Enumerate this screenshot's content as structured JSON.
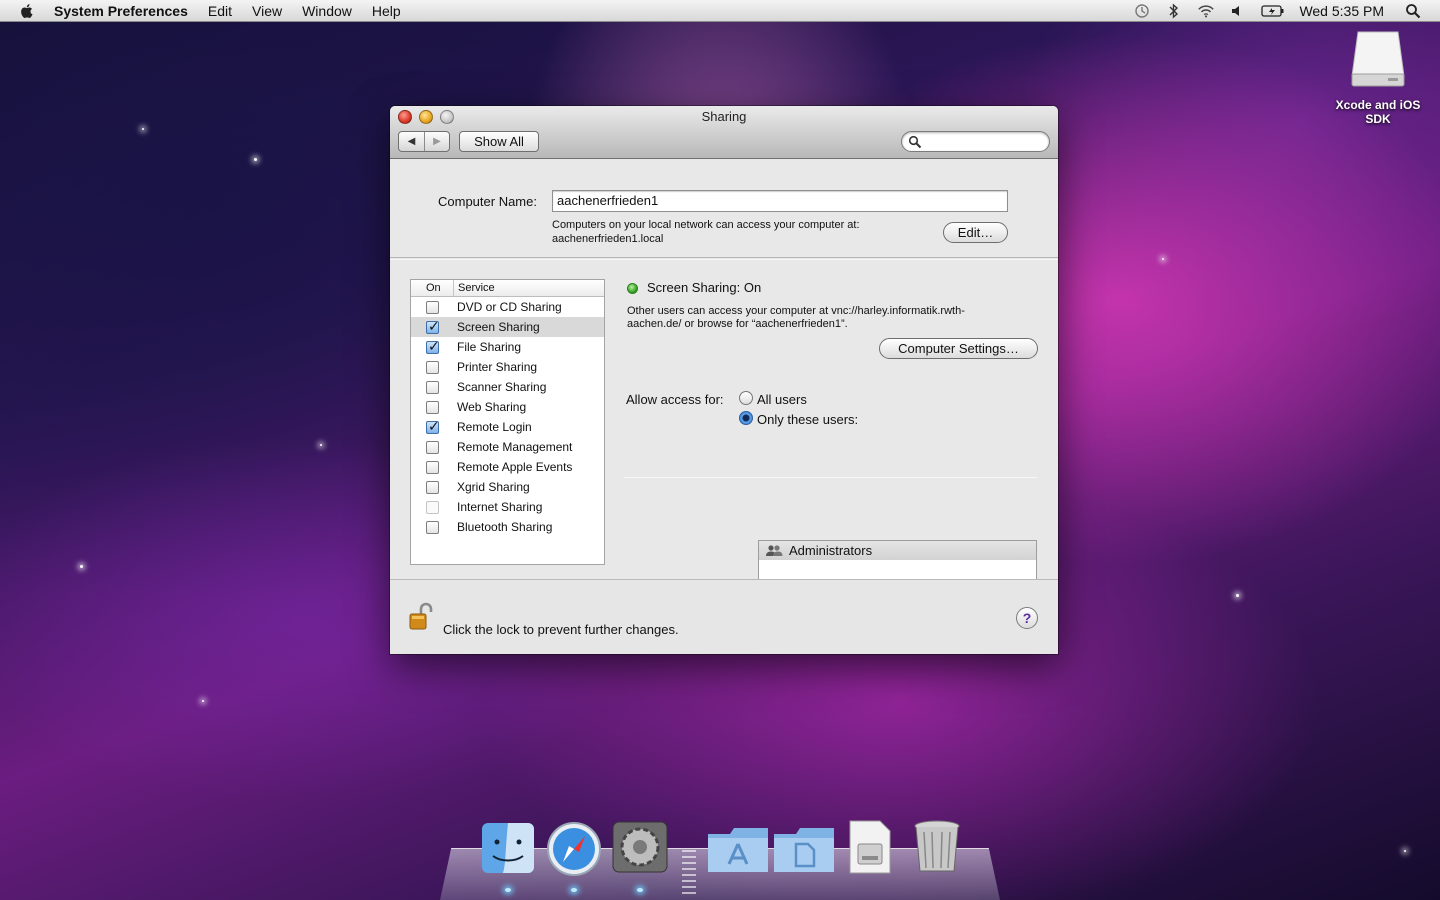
{
  "menubar": {
    "app": "System Preferences",
    "items": [
      "Edit",
      "View",
      "Window",
      "Help"
    ],
    "clock": "Wed 5:35 PM"
  },
  "desktop": {
    "disk_label": "Xcode and iOS SDK"
  },
  "window": {
    "title": "Sharing",
    "show_all": "Show All",
    "search_placeholder": "",
    "computer_name_label": "Computer Name:",
    "computer_name_value": "aachenerfrieden1",
    "local_note_line1": "Computers on your local network can access your computer at:",
    "local_note_line2": "aachenerfrieden1.local",
    "edit_button": "Edit…",
    "services": {
      "col_on": "On",
      "col_service": "Service",
      "items": [
        {
          "label": "DVD or CD Sharing",
          "checked": false,
          "enabled": true
        },
        {
          "label": "Screen Sharing",
          "checked": true,
          "enabled": true,
          "selected": true
        },
        {
          "label": "File Sharing",
          "checked": true,
          "enabled": true
        },
        {
          "label": "Printer Sharing",
          "checked": false,
          "enabled": true
        },
        {
          "label": "Scanner Sharing",
          "checked": false,
          "enabled": true
        },
        {
          "label": "Web Sharing",
          "checked": false,
          "enabled": true
        },
        {
          "label": "Remote Login",
          "checked": true,
          "enabled": true
        },
        {
          "label": "Remote Management",
          "checked": false,
          "enabled": true
        },
        {
          "label": "Remote Apple Events",
          "checked": false,
          "enabled": true
        },
        {
          "label": "Xgrid Sharing",
          "checked": false,
          "enabled": true
        },
        {
          "label": "Internet Sharing",
          "checked": false,
          "enabled": false
        },
        {
          "label": "Bluetooth Sharing",
          "checked": false,
          "enabled": true
        }
      ]
    },
    "detail": {
      "status": "Screen Sharing: On",
      "status_color": "#3ca52a",
      "desc_line1": "Other users can access your computer at vnc://harley.informatik.rwth-",
      "desc_line2": "aachen.de/ or browse for “aachenerfrieden1”.",
      "computer_settings": "Computer Settings…",
      "allow_access_label": "Allow access for:",
      "opt_all": "All users",
      "opt_only": "Only these users:",
      "selected_option": "only",
      "users": [
        "Administrators"
      ],
      "add": "+",
      "remove": "−"
    },
    "lock_text": "Click the lock to prevent further changes.",
    "help": "?"
  },
  "dock": {
    "items": [
      "finder-icon",
      "safari-icon",
      "system-preferences-icon",
      "applications-folder-icon",
      "documents-folder-icon",
      "disk-image-icon",
      "trash-icon"
    ]
  }
}
